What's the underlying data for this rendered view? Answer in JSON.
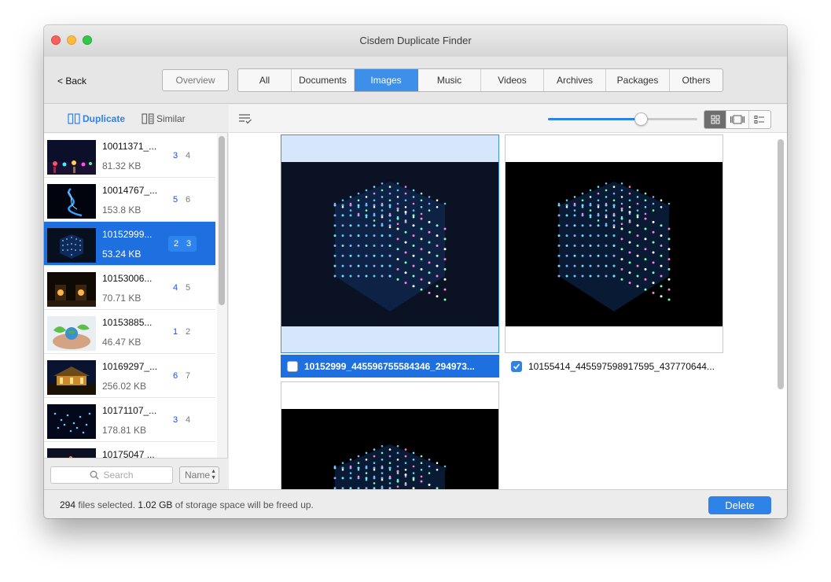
{
  "window": {
    "title": "Cisdem Duplicate Finder"
  },
  "toolbar": {
    "back_label": "< Back",
    "overview_label": "Overview",
    "tabs": [
      {
        "label": "All",
        "active": false
      },
      {
        "label": "Documents",
        "active": false
      },
      {
        "label": "Images",
        "active": true
      },
      {
        "label": "Music",
        "active": false
      },
      {
        "label": "Videos",
        "active": false
      },
      {
        "label": "Archives",
        "active": false
      },
      {
        "label": "Packages",
        "active": false
      },
      {
        "label": "Others",
        "active": false
      }
    ]
  },
  "sidebar": {
    "mode_duplicate": "Duplicate",
    "mode_similar": "Similar",
    "items": [
      {
        "name": "10011371_...",
        "size": "81.32 KB",
        "count_a": "3",
        "count_b": "4",
        "selected": false,
        "thumb": "city-night"
      },
      {
        "name": "10014767_...",
        "size": "153.8 KB",
        "count_a": "5",
        "count_b": "6",
        "selected": false,
        "thumb": "blue-swirl"
      },
      {
        "name": "10152999...",
        "size": "53.24 KB",
        "count_a": "2",
        "count_b": "3",
        "selected": true,
        "thumb": "led-cube"
      },
      {
        "name": "10153006...",
        "size": "70.71 KB",
        "count_a": "4",
        "count_b": "5",
        "selected": false,
        "thumb": "candles"
      },
      {
        "name": "10153885...",
        "size": "46.47 KB",
        "count_a": "1",
        "count_b": "2",
        "selected": false,
        "thumb": "hands-globe"
      },
      {
        "name": "10169297_...",
        "size": "256.02 KB",
        "count_a": "6",
        "count_b": "7",
        "selected": false,
        "thumb": "palace-night"
      },
      {
        "name": "10171107_...",
        "size": "178.81 KB",
        "count_a": "3",
        "count_b": "4",
        "selected": false,
        "thumb": "blue-lights"
      },
      {
        "name": "10175047 ...",
        "size": "",
        "count_a": "",
        "count_b": "",
        "selected": false,
        "thumb": "city-night"
      }
    ],
    "search_placeholder": "Search",
    "sort_label": "Name"
  },
  "main": {
    "zoom_percent": 62,
    "view_modes": [
      "grid-view-icon",
      "filmstrip-view-icon",
      "list-view-icon"
    ],
    "active_view": "grid-view-icon",
    "files": [
      {
        "name": "10152999_445596755584346_294973...",
        "checked": false,
        "selected": true
      },
      {
        "name": "10155414_445597598917595_437770644...",
        "checked": true,
        "selected": false
      },
      {
        "name": "",
        "checked": false,
        "selected": false
      }
    ]
  },
  "status": {
    "count": "294",
    "text_a": " files selected. ",
    "size": "1.02 GB",
    "text_b": " of storage space will be freed up.",
    "delete_label": "Delete"
  },
  "colors": {
    "accent": "#2e82e8",
    "selection": "#1e6fe0",
    "selection_light": "#d6e6fb"
  }
}
